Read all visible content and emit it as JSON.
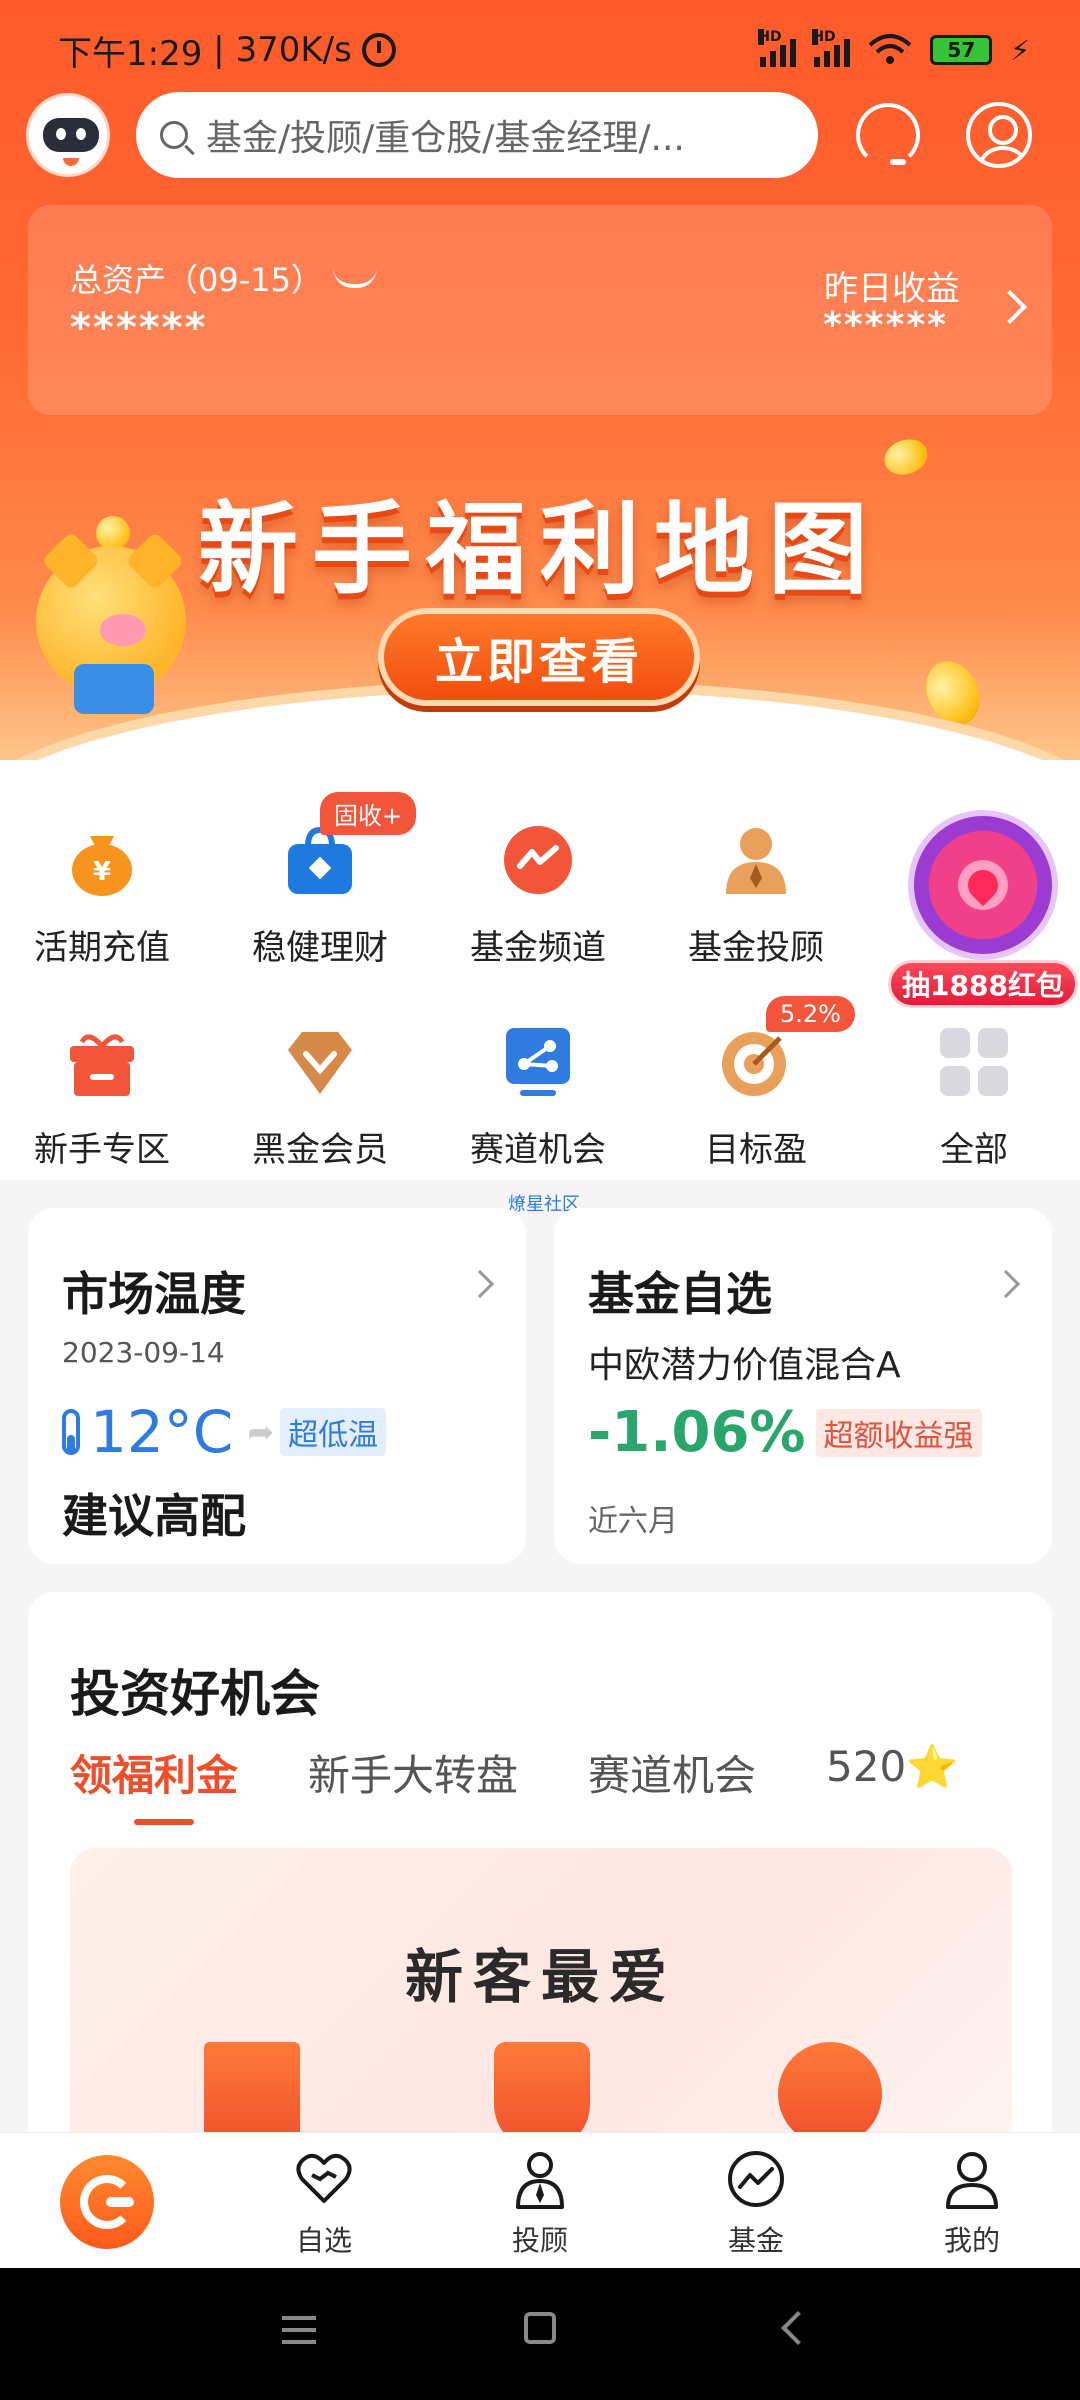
{
  "status_bar": {
    "time": "下午1:29",
    "net_speed": "370K/s",
    "battery": "57",
    "net_label": "HD"
  },
  "search": {
    "placeholder": "基金/投顾/重仓股/基金经理/..."
  },
  "asset": {
    "total_label": "总资产（09-15）",
    "total_value": "******",
    "yesterday_label": "昨日收益",
    "yesterday_value": "******"
  },
  "banner": {
    "title": "新手福利地图",
    "button": "立即查看"
  },
  "menu": {
    "row1": [
      {
        "label": "活期充值",
        "icon": "money-bag-icon"
      },
      {
        "label": "稳健理财",
        "icon": "shopping-bag-icon",
        "tag": "固收+"
      },
      {
        "label": "基金频道",
        "icon": "trend-icon"
      },
      {
        "label": "基金投顾",
        "icon": "advisor-icon"
      }
    ],
    "row2": [
      {
        "label": "新手专区",
        "icon": "gift-icon"
      },
      {
        "label": "黑金会员",
        "icon": "diamond-icon"
      },
      {
        "label": "赛道机会",
        "icon": "track-icon"
      },
      {
        "label": "目标盈",
        "icon": "target-icon",
        "tag": "5.2%"
      },
      {
        "label": "全部",
        "icon": "grid-icon"
      }
    ],
    "lottery": "抽1888红包",
    "community_label": "燎星社区"
  },
  "market_temp": {
    "title": "市场温度",
    "date": "2023-09-14",
    "value": "12°C",
    "level": "超低温",
    "advice": "建议高配"
  },
  "fund_pick": {
    "title": "基金自选",
    "name": "中欧潜力价值混合A",
    "change": "-1.06%",
    "tag": "超额收益强",
    "period": "近六月"
  },
  "opportunities": {
    "title": "投资好机会",
    "tabs": [
      "领福利金",
      "新手大转盘",
      "赛道机会",
      "520⭐"
    ],
    "promo_title": "新客最爱"
  },
  "bottom_nav": {
    "items": [
      "自选",
      "投顾",
      "基金",
      "我的"
    ]
  },
  "colors": {
    "brand": "#ff5a2a",
    "down_green": "#2aa56c",
    "cold_blue": "#2f7be0",
    "accent_red": "#ef4e2b"
  }
}
